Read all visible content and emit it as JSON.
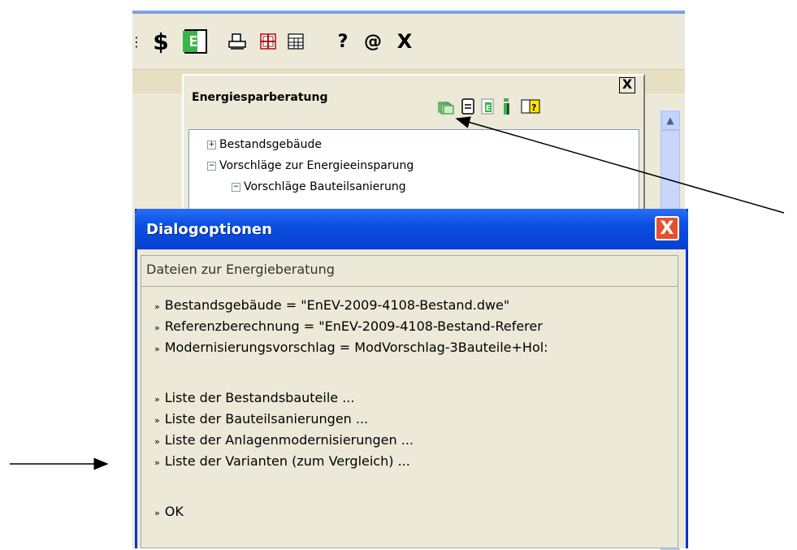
{
  "toolbar": {
    "icons": [
      "more-icon",
      "dollar-icon",
      "energy-e-icon",
      "print-icon",
      "grid-icon",
      "table-icon",
      "help-icon",
      "at-icon",
      "close-icon"
    ],
    "help_glyph": "?",
    "at_glyph": "@",
    "close_glyph": "X",
    "e_letter": "E"
  },
  "panel": {
    "title": "Energiesparberatung",
    "close_glyph": "X",
    "icons": [
      "files-icon",
      "document-icon",
      "energy-doc-icon",
      "info-icon",
      "book-help-icon"
    ],
    "tree": [
      {
        "label": "Bestandsgebäude",
        "toggle": "+"
      },
      {
        "label": "Vorschläge zur Energieeinsparung",
        "toggle": "−"
      },
      {
        "label": "Vorschläge Bauteilsanierung",
        "toggle": "−"
      }
    ]
  },
  "dialog": {
    "title": "Dialogoptionen",
    "close_glyph": "X",
    "header": "Dateien zur Energieberatung",
    "bullet": "»",
    "files": [
      "Bestandsgebäude = \"EnEV-2009-4108-Bestand.dwe\"",
      "Referenzberechnung = \"EnEV-2009-4108-Bestand-Referer",
      "Modernisierungsvorschlag = ModVorschlag-3Bauteile+Hol:"
    ],
    "lists": [
      "Liste der Bestandsbauteile ...",
      "Liste der Bauteilsanierungen ...",
      "Liste der Anlagenmodernisierungen ...",
      "Liste der Varianten (zum Vergleich) ..."
    ],
    "ok": "OK"
  },
  "colors": {
    "titlebar": "#0a4fe0",
    "close_red": "#e5512e",
    "panel_bg": "#ece9d8"
  }
}
